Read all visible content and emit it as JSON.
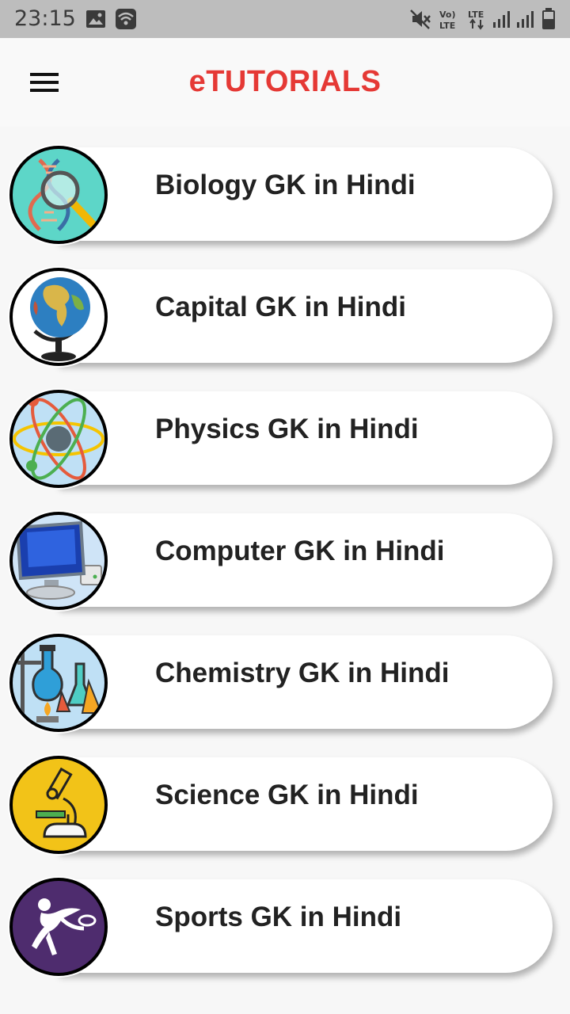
{
  "status_bar": {
    "time": "23:15",
    "icons": [
      "image-icon",
      "wifi-hotspot-icon",
      "mute-icon",
      "volte-icon",
      "lte-icon",
      "signal-icon",
      "signal-icon",
      "battery-icon"
    ]
  },
  "app_bar": {
    "title": "eTUTORIALS",
    "menu_icon": "hamburger-menu-icon",
    "title_color": "#e53935"
  },
  "topics": [
    {
      "label": "Biology GK in Hindi",
      "icon": "dna-magnifier-icon"
    },
    {
      "label": "Capital GK in Hindi",
      "icon": "globe-icon"
    },
    {
      "label": "Physics GK in Hindi",
      "icon": "atom-icon"
    },
    {
      "label": "Computer GK in Hindi",
      "icon": "computer-icon"
    },
    {
      "label": "Chemistry GK in Hindi",
      "icon": "lab-flask-icon"
    },
    {
      "label": "Science GK in Hindi",
      "icon": "microscope-icon"
    },
    {
      "label": "Sports GK in Hindi",
      "icon": "athlete-icon"
    }
  ]
}
